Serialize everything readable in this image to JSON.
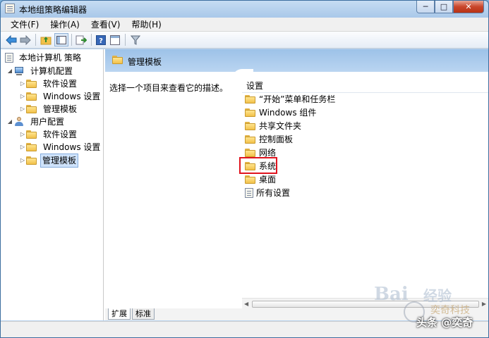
{
  "window": {
    "title": "本地组策略编辑器",
    "minimize": "─",
    "maximize": "□",
    "close": "✕"
  },
  "menu": [
    "文件(F)",
    "操作(A)",
    "查看(V)",
    "帮助(H)"
  ],
  "toolbar_icons": [
    "back-arrow-icon",
    "forward-arrow-icon",
    "up-folder-icon",
    "show-tree-icon",
    "export-list-icon",
    "help-icon",
    "properties-icon",
    "filter-icon"
  ],
  "tree": {
    "root": "本地计算机 策略",
    "computer": "计算机配置",
    "computer_children": [
      "软件设置",
      "Windows 设置",
      "管理模板"
    ],
    "user": "用户配置",
    "user_children": [
      "软件设置",
      "Windows 设置",
      "管理模板"
    ],
    "selected": "管理模板"
  },
  "right": {
    "header_title": "管理模板",
    "description": "选择一个项目来查看它的描述。",
    "column_header": "设置",
    "items": [
      "“开始”菜单和任务栏",
      "Windows 组件",
      "共享文件夹",
      "控制面板",
      "网络",
      "系统",
      "桌面",
      "所有设置"
    ],
    "highlighted_item": "系统"
  },
  "tabs": [
    "扩展",
    "标准"
  ],
  "watermark": {
    "baidu": "Bai",
    "jingyan": "经验",
    "tech": "奕奇科技",
    "toutiao": "头条 @奕奇"
  }
}
